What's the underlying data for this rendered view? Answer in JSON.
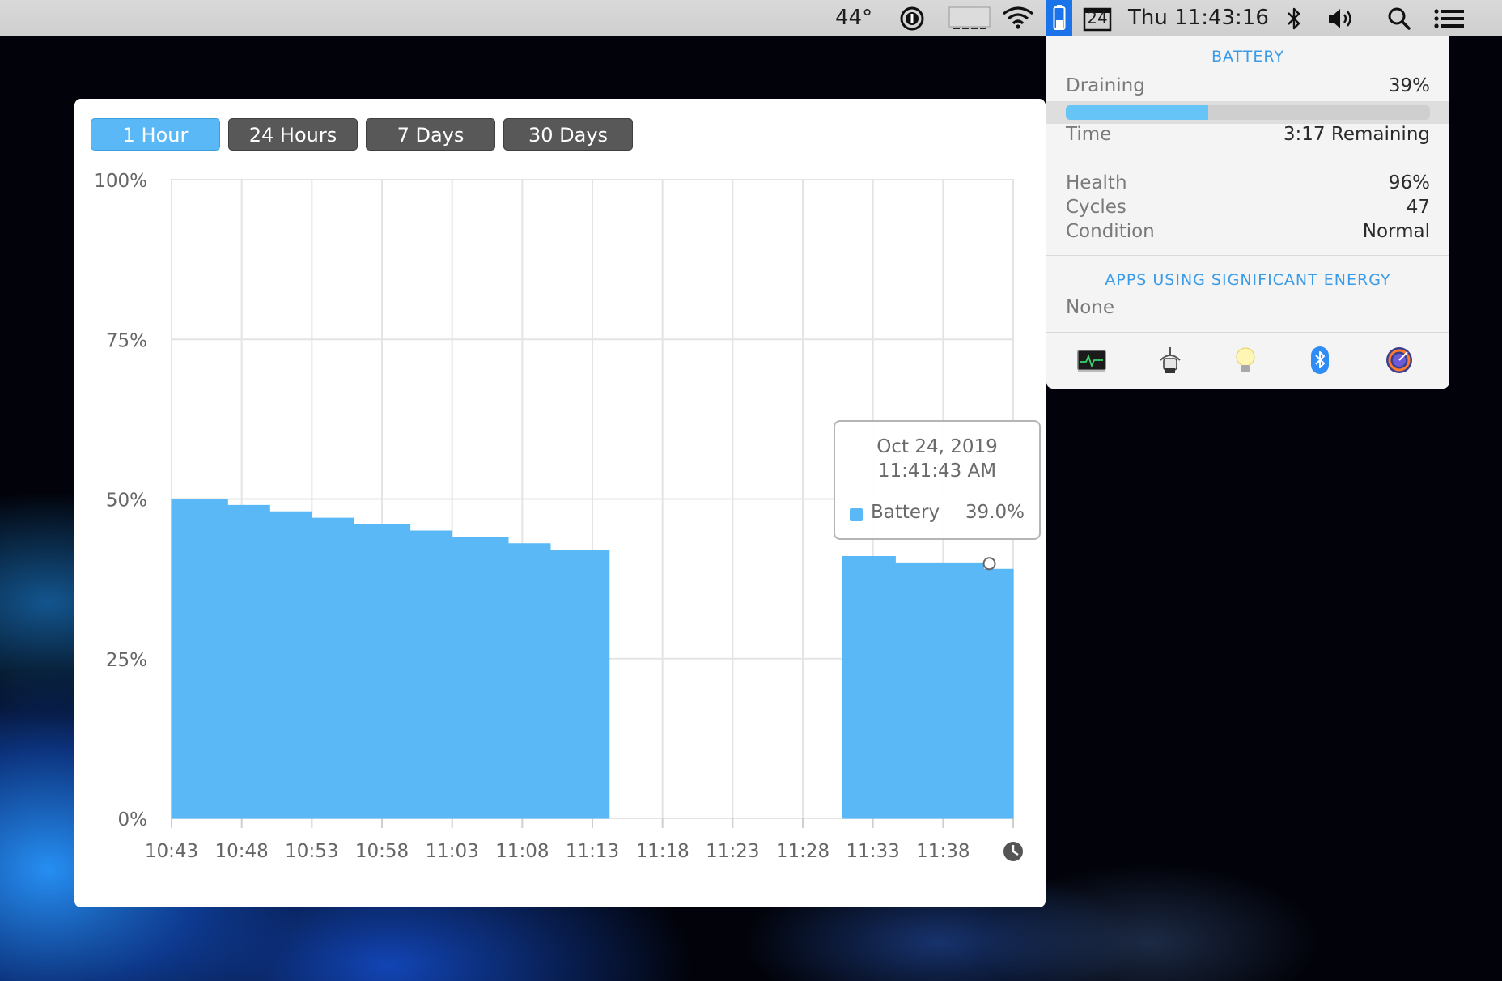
{
  "menubar": {
    "temperature": "44°",
    "calendar_day": "24",
    "clock": "Thu 11:43:16",
    "icons": [
      "1password-icon",
      "keyboard-icon",
      "wifi-icon",
      "battery-icon",
      "calendar-icon",
      "bluetooth-icon",
      "volume-icon",
      "spotlight-search-icon",
      "notification-center-icon"
    ]
  },
  "window": {
    "ranges": [
      "1 Hour",
      "24 Hours",
      "7 Days",
      "30 Days"
    ],
    "active_range": "1 Hour",
    "clock_icon": "history-clock-icon"
  },
  "chart_data": {
    "type": "area",
    "title": "",
    "xlabel": "",
    "ylabel": "",
    "ylim": [
      0,
      100
    ],
    "y_ticks": [
      "0%",
      "25%",
      "50%",
      "75%",
      "100%"
    ],
    "x_ticks": [
      "10:43",
      "10:48",
      "10:53",
      "10:58",
      "11:03",
      "11:08",
      "11:13",
      "11:18",
      "11:23",
      "11:28",
      "11:33",
      "11:38"
    ],
    "grid": true,
    "series": [
      {
        "name": "Battery",
        "color": "#5ab8f6",
        "segments": [
          [
            [
              0,
              50
            ],
            [
              4,
              50
            ],
            [
              4,
              49
            ],
            [
              7,
              49
            ],
            [
              7,
              48
            ],
            [
              10,
              48
            ],
            [
              10,
              47
            ],
            [
              13,
              47
            ],
            [
              13,
              46
            ],
            [
              17,
              46
            ],
            [
              17,
              45
            ],
            [
              20,
              45
            ],
            [
              20,
              44
            ],
            [
              24,
              44
            ],
            [
              24,
              43
            ],
            [
              27,
              43
            ],
            [
              27,
              42
            ],
            [
              31.2,
              42
            ]
          ],
          [
            [
              47.8,
              41
            ],
            [
              51.6,
              41
            ],
            [
              51.6,
              40
            ],
            [
              57.9,
              40
            ],
            [
              57.9,
              39
            ],
            [
              60,
              39
            ]
          ]
        ]
      }
    ],
    "hover_point": {
      "minute": 58.3,
      "value": 39.0
    }
  },
  "tooltip": {
    "date": "Oct 24, 2019",
    "time": "11:41:43 AM",
    "series": "Battery",
    "value": "39.0%"
  },
  "battery": {
    "header": "BATTERY",
    "state_label": "Draining",
    "percent": "39%",
    "charge_fraction": 0.39,
    "time_label": "Time",
    "time_value": "3:17 Remaining",
    "health_label": "Health",
    "health_value": "96%",
    "cycles_label": "Cycles",
    "cycles_value": "47",
    "condition_label": "Condition",
    "condition_value": "Normal",
    "apps_header": "APPS USING SIGNIFICANT ENERGY",
    "apps_value": "None",
    "tools": [
      "activity-monitor-icon",
      "energy-saver-icon",
      "light-bulb-icon",
      "bluetooth-app-icon",
      "disk-utility-icon"
    ]
  }
}
